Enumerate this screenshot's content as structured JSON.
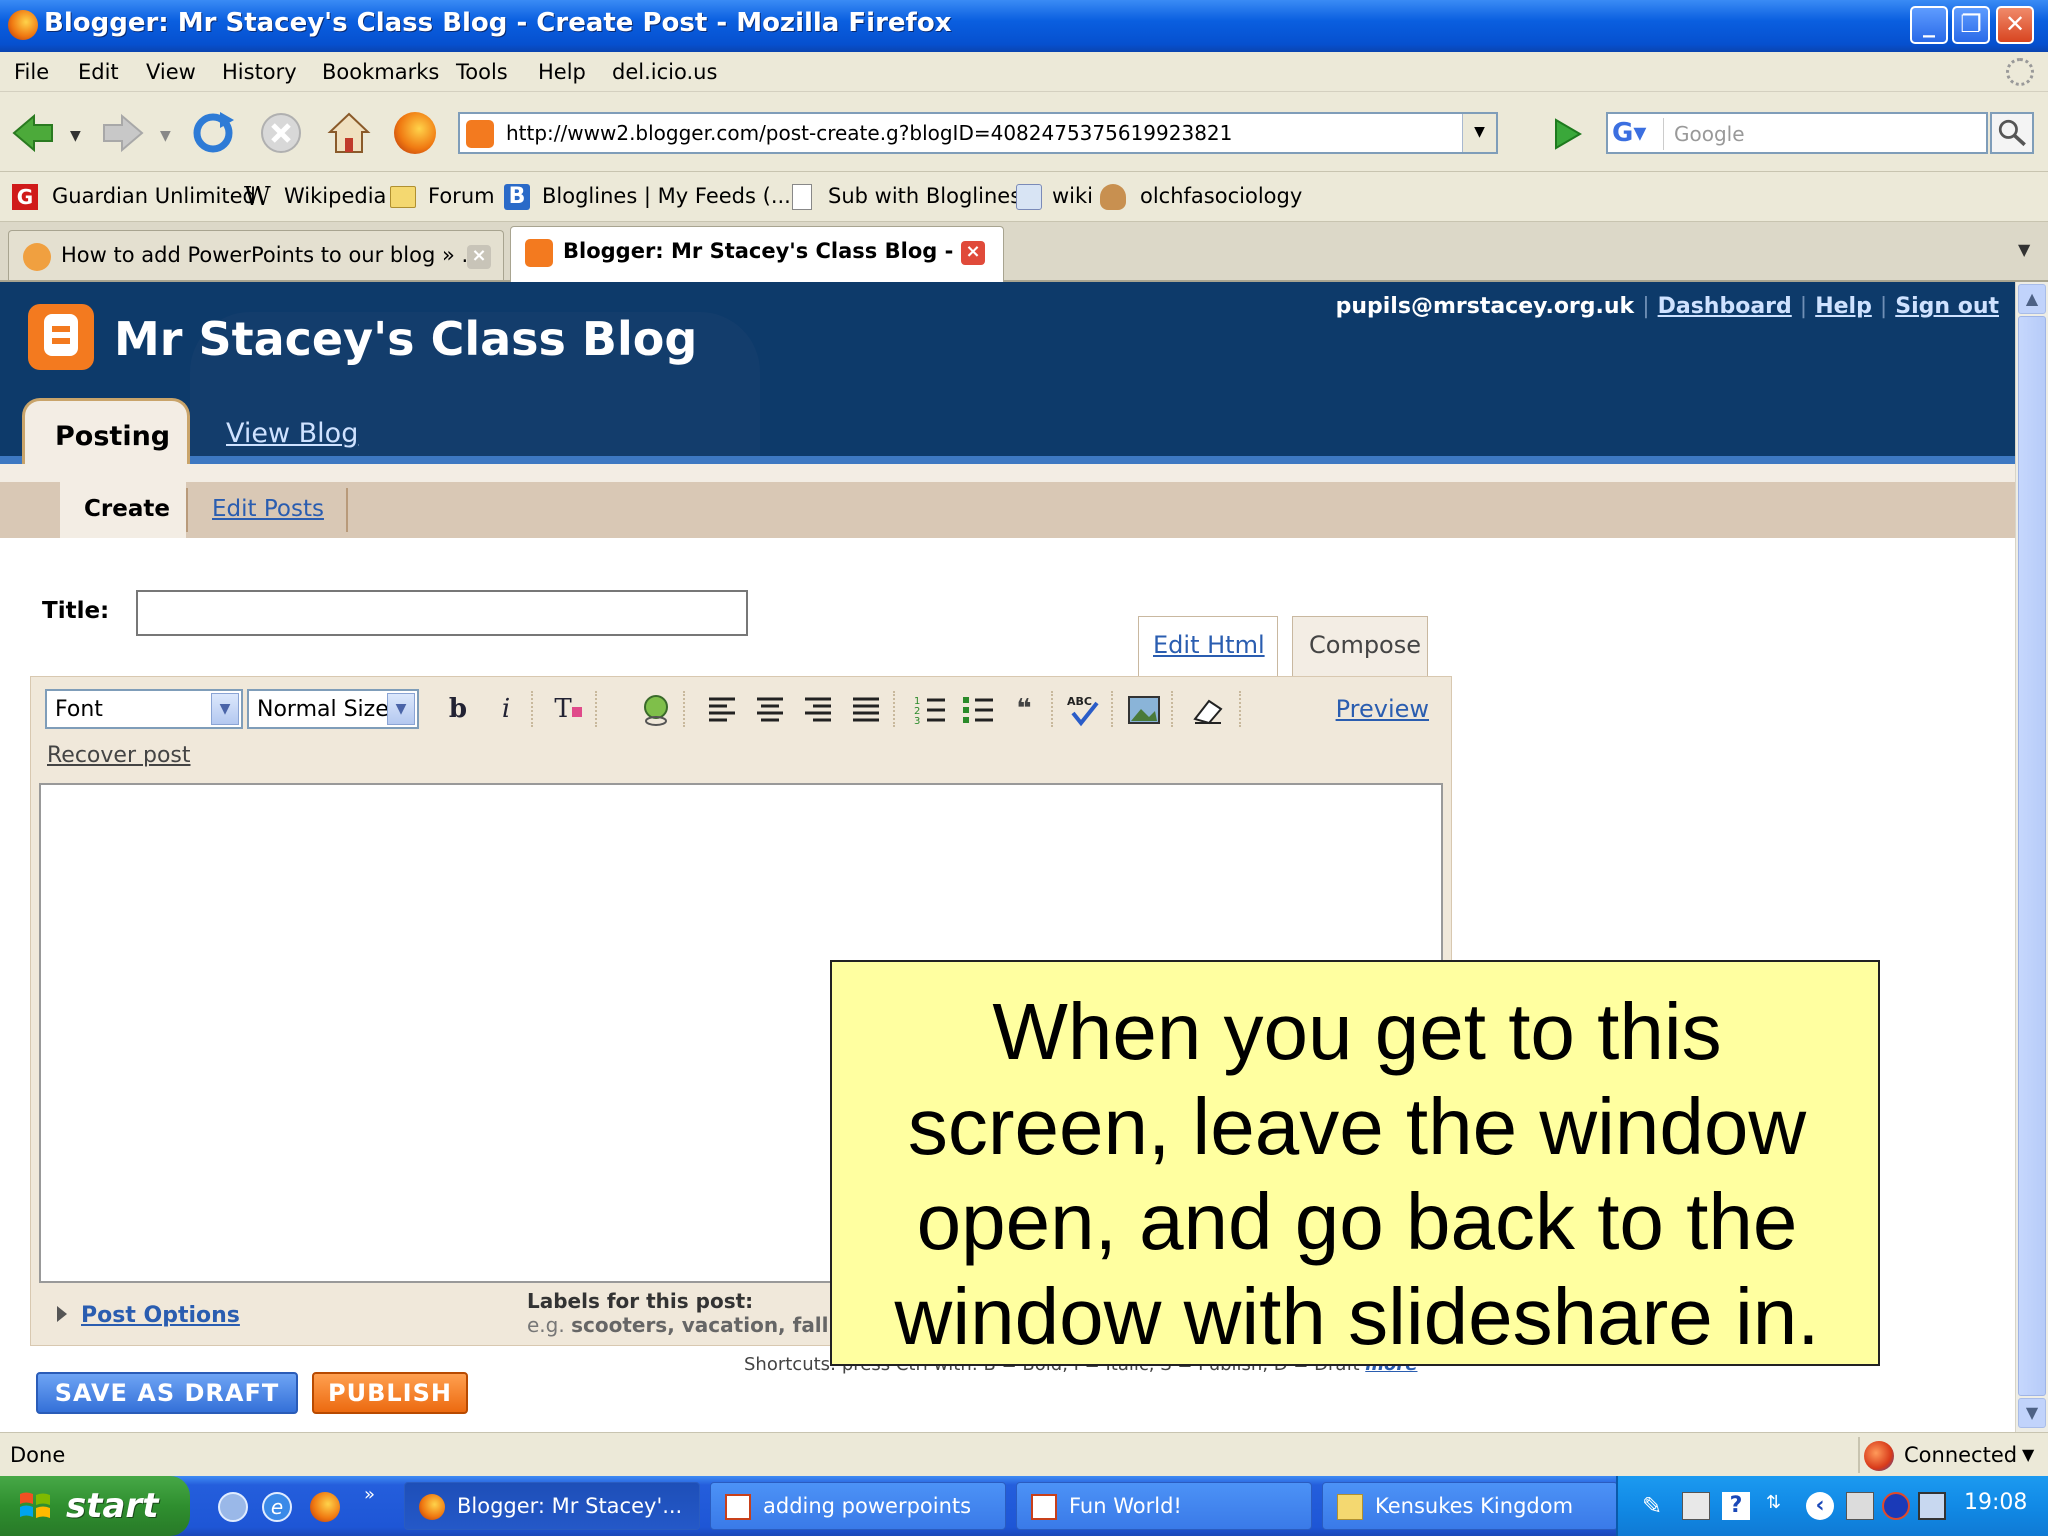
{
  "window": {
    "title": "Blogger: Mr Stacey's Class Blog - Create Post - Mozilla Firefox"
  },
  "menu": [
    "File",
    "Edit",
    "View",
    "History",
    "Bookmarks",
    "Tools",
    "Help",
    "del.icio.us"
  ],
  "navigation": {
    "url": "http://www2.blogger.com/post-create.g?blogID=4082475375619923821",
    "search_placeholder": "Google"
  },
  "bookmarks": [
    "Guardian Unlimited",
    "Wikipedia",
    "Forum",
    "Bloglines | My Feeds (...",
    "Sub with Bloglines",
    "wiki",
    "olchfasociology"
  ],
  "tabs": [
    {
      "label": "How to add PowerPoints to our blog » ...",
      "active": false
    },
    {
      "label": "Blogger: Mr Stacey's Class Blog - ...",
      "active": true
    }
  ],
  "blogger": {
    "blog_title": "Mr Stacey's Class Blog",
    "account_email": "pupils@mrstacey.org.uk",
    "links": [
      "Dashboard",
      "Help",
      "Sign out"
    ],
    "main_tabs": [
      "Posting",
      "View Blog"
    ],
    "sub_tabs": [
      "Create",
      "Edit Posts"
    ]
  },
  "editor": {
    "title_label": "Title:",
    "title_value": "",
    "mode_tabs": [
      "Edit Html",
      "Compose"
    ],
    "font_select": "Font",
    "size_select": "Normal Size",
    "preview_label": "Preview",
    "recover_label": "Recover post",
    "post_options_label": "Post Options",
    "labels_heading": "Labels for this post:",
    "labels_hint_prefix": "e.g.",
    "labels_hint_examples": "scooters, vacation, fall",
    "shortcuts_text": "Shortcuts: press Ctrl with: B = Bold, I = Italic, S = Publish, D = Draft",
    "shortcuts_more": "more",
    "save_draft_label": "SAVE AS DRAFT",
    "publish_label": "PUBLISH"
  },
  "callout": {
    "text": "When you get to this screen, leave the window open, and go back to the window with slideshare in."
  },
  "status": {
    "left": "Done",
    "right": "Connected"
  },
  "taskbar": {
    "start_label": "start",
    "tasks": [
      "Blogger: Mr Stacey'...",
      "adding powerpoints",
      "Fun World!",
      "Kensukes Kingdom"
    ],
    "clock": "19:08"
  },
  "colors": {
    "blogger_header": "#0d3a6a",
    "blogger_orange": "#f37a1f",
    "callout_bg": "#ffffa0",
    "link_blue": "#2a5db0",
    "save_blue": "#3470d8",
    "publish_orange": "#ec6a10"
  }
}
